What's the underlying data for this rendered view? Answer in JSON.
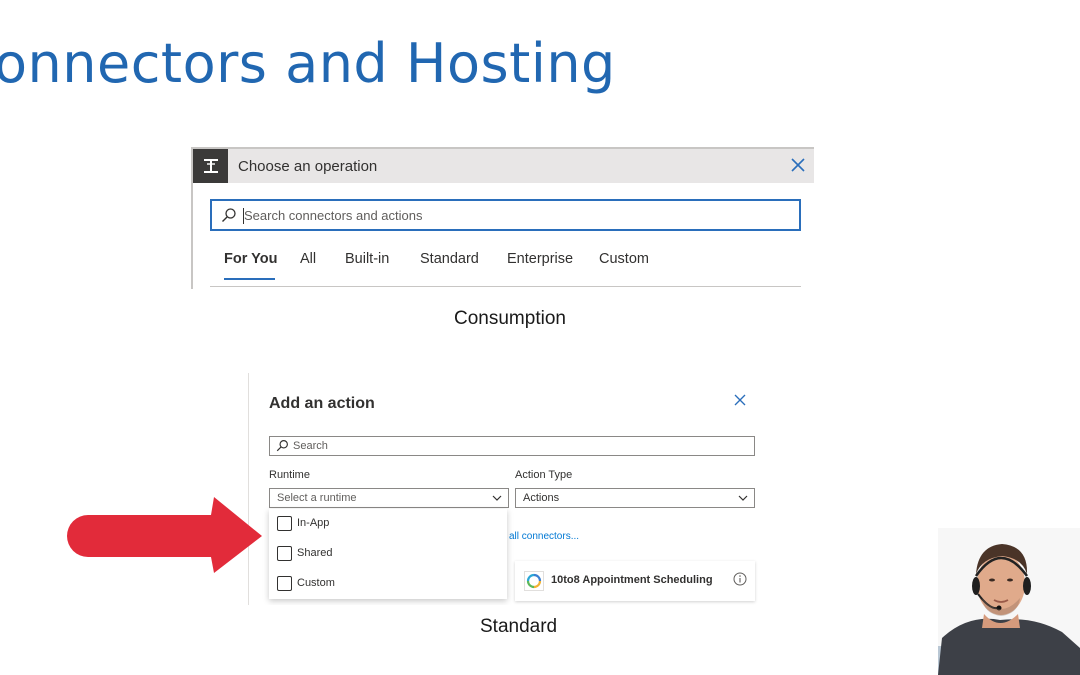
{
  "slide": {
    "title": "onnectors and Hosting"
  },
  "consumption": {
    "header_title": "Choose an operation",
    "search_placeholder": "Search connectors and actions",
    "tabs": [
      {
        "label": "For You",
        "active": true
      },
      {
        "label": "All",
        "active": false
      },
      {
        "label": "Built-in",
        "active": false
      },
      {
        "label": "Standard",
        "active": false
      },
      {
        "label": "Enterprise",
        "active": false
      },
      {
        "label": "Custom",
        "active": false
      }
    ],
    "caption": "Consumption"
  },
  "standard": {
    "title": "Add an action",
    "search_placeholder": "Search",
    "runtime_label": "Runtime",
    "runtime_placeholder": "Select a runtime",
    "action_type_label": "Action Type",
    "action_type_value": "Actions",
    "browse_link": "all connectors...",
    "runtime_options": [
      "In-App",
      "Shared",
      "Custom"
    ],
    "connector": {
      "name": "10to8 Appointment Scheduling"
    },
    "caption": "Standard"
  },
  "colors": {
    "title_blue": "#2167b1",
    "accent": "#2a6ebb",
    "arrow_red": "#e22b3a",
    "link": "#0078d4"
  },
  "icons": {
    "consumption_header": "operation-icon",
    "close": "close-icon",
    "search": "search-icon",
    "chevron": "chevron-down-icon",
    "info": "info-icon",
    "arrow": "red-arrow-right"
  }
}
